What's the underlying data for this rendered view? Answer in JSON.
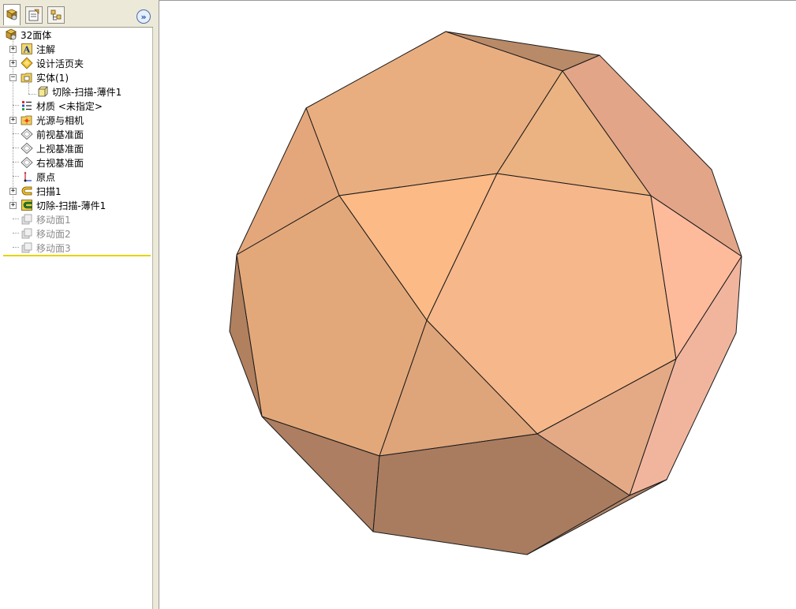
{
  "tree": {
    "root": "32面体",
    "items": [
      {
        "label": "注解"
      },
      {
        "label": "设计活页夹"
      },
      {
        "label": "实体(1)"
      },
      {
        "label": "切除-扫描-薄件1"
      },
      {
        "label": "材质 <未指定>"
      },
      {
        "label": "光源与相机"
      },
      {
        "label": "前视基准面"
      },
      {
        "label": "上视基准面"
      },
      {
        "label": "右视基准面"
      },
      {
        "label": "原点"
      },
      {
        "label": "扫描1"
      },
      {
        "label": "切除-扫描-薄件1"
      },
      {
        "label": "移动面1"
      },
      {
        "label": "移动面2"
      },
      {
        "label": "移动面3"
      }
    ]
  },
  "colors": {
    "rollback_bar": "#e7d200",
    "face_light": "#f8b988",
    "face_dark": "#a97c60"
  }
}
